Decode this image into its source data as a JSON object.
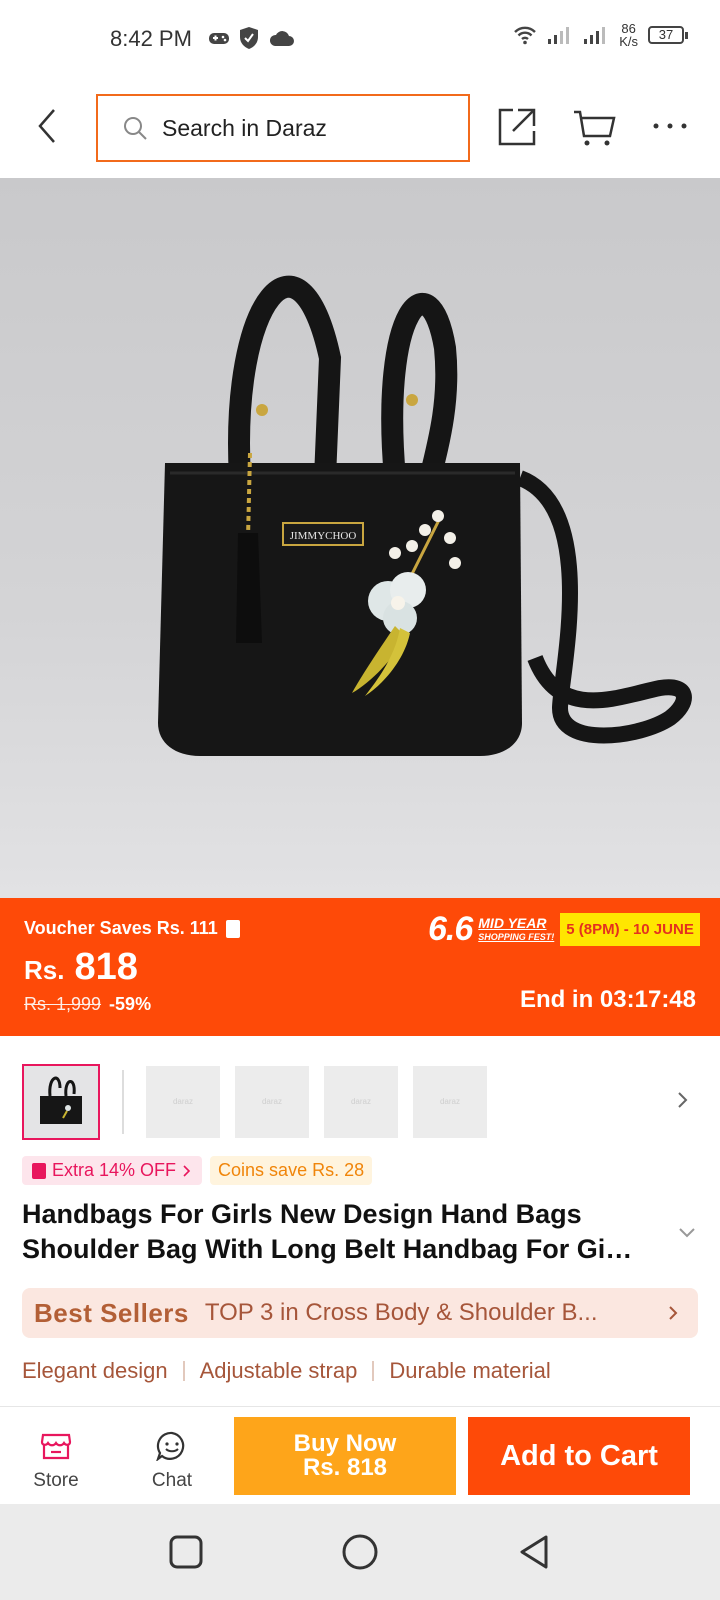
{
  "status_bar": {
    "time": "8:42 PM",
    "network_speed_value": "86",
    "network_speed_unit": "K/s",
    "battery": "37"
  },
  "search": {
    "placeholder": "Search in Daraz"
  },
  "product_image": {
    "brand_plate": "JIMMYCHOO"
  },
  "price_banner": {
    "voucher": "Voucher Saves Rs. 111",
    "currency": "Rs.",
    "price": "818",
    "old_price": "Rs. 1,999",
    "discount": "-59%",
    "campaign_number": "6.6",
    "campaign_title": "MID YEAR",
    "campaign_sub": "SHOPPING FEST!",
    "campaign_dates": "5 (8PM) - 10 JUNE",
    "end_timer": "End in 03:17:48"
  },
  "thumbnails": {
    "placeholder_text": "daraz"
  },
  "promos": {
    "extra_off": "Extra 14% OFF",
    "coins": "Coins save Rs. 28"
  },
  "product": {
    "title": "Handbags For Girls New Design Hand Bags Shoulder Bag With Long Belt Handbag For Gi…"
  },
  "best_sellers": {
    "badge": "Best Sellers",
    "text": "TOP 3 in Cross Body & Shoulder B..."
  },
  "features": [
    "Elegant design",
    "Adjustable strap",
    "Durable material"
  ],
  "action_bar": {
    "store_label": "Store",
    "chat_label": "Chat",
    "buy_now_label": "Buy Now",
    "buy_now_price": "Rs. 818",
    "add_to_cart_label": "Add to Cart"
  },
  "colors": {
    "brand_orange": "#fe4a08",
    "buy_now_yellow": "#fea51a",
    "promo_pink": "#e8165d"
  }
}
